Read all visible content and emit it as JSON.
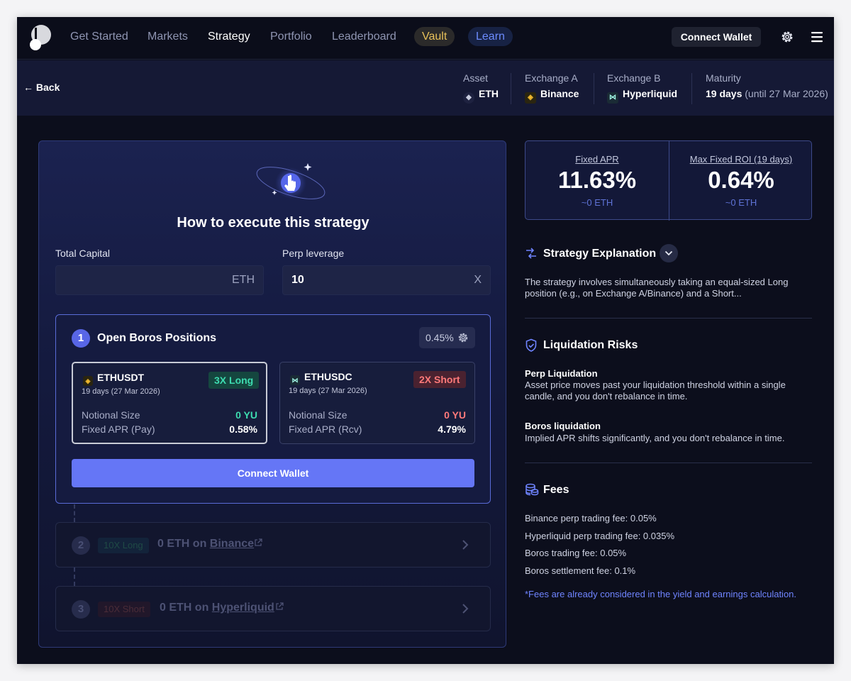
{
  "nav": {
    "items": [
      "Get Started",
      "Markets",
      "Strategy",
      "Portfolio",
      "Leaderboard"
    ],
    "vault": "Vault",
    "learn": "Learn",
    "connect_wallet": "Connect Wallet"
  },
  "subheader": {
    "back": "← Back",
    "asset_label": "Asset",
    "asset": "ETH",
    "exchange_a_label": "Exchange A",
    "exchange_a": "Binance",
    "exchange_b_label": "Exchange B",
    "exchange_b": "Hyperliquid",
    "maturity_label": "Maturity",
    "maturity": "19 days",
    "maturity_until": "(until 27 Mar 2026)"
  },
  "strategy": {
    "title": "How to execute this strategy",
    "total_capital_label": "Total Capital",
    "total_capital_value": "",
    "total_capital_unit": "ETH",
    "leverage_label": "Perp leverage",
    "leverage_value": "10",
    "leverage_unit": "X",
    "step1": {
      "num": "1",
      "title": "Open Boros Positions",
      "slippage": "0.45%",
      "positions": [
        {
          "symbol": "ETHUSDT",
          "date": "19 days  (27 Mar 2026)",
          "tag": "3X Long",
          "notional_label": "Notional Size",
          "notional": "0 YU",
          "apr_label": "Fixed APR (Pay)",
          "apr": "0.58%"
        },
        {
          "symbol": "ETHUSDC",
          "date": "19 days  (27 Mar 2026)",
          "tag": "2X Short",
          "notional_label": "Notional Size",
          "notional": "0 YU",
          "apr_label": "Fixed APR (Rcv)",
          "apr": "4.79%"
        }
      ],
      "button": "Connect Wallet"
    },
    "step2": {
      "num": "2",
      "lev": "10X Long",
      "text_prefix": "0 ETH on",
      "exchange": "Binance"
    },
    "step3": {
      "num": "3",
      "lev": "10X Short",
      "text_prefix": "0 ETH on",
      "exchange": "Hyperliquid"
    }
  },
  "stats": {
    "fixed_apr_label": "Fixed APR",
    "fixed_apr": "11.63%",
    "fixed_apr_sub": "~0 ETH",
    "roi_label": "Max Fixed ROI (19 days)",
    "roi": "0.64%",
    "roi_sub": "~0 ETH"
  },
  "explanation": {
    "title": "Strategy Explanation",
    "text": "The strategy involves simultaneously taking an equal-sized Long position (e.g., on Exchange A/Binance) and a Short..."
  },
  "risks": {
    "title": "Liquidation Risks",
    "perp_title": "Perp Liquidation",
    "perp_text": "Asset price moves past your liquidation threshold within a single candle, and you don't rebalance in time.",
    "boros_title": "Boros liquidation",
    "boros_text": "Implied APR shifts significantly, and you don't rebalance in time."
  },
  "fees": {
    "title": "Fees",
    "items": [
      "Binance perp trading fee: 0.05%",
      "Hyperliquid perp trading fee: 0.035%",
      "Boros trading fee: 0.05%",
      "Boros settlement fee: 0.1%"
    ],
    "note": "*Fees are already considered in the yield and earnings calculation."
  },
  "colors": {
    "background": "#0c0e1c",
    "accent": "#6576f6",
    "long": "#3ddbb0",
    "short": "#ff7a7a",
    "vault": "#e8c15a",
    "learn": "#6d8cff"
  },
  "icons": [
    "logo",
    "gear-icon",
    "menu-icon",
    "eth-icon",
    "binance-icon",
    "hyperliquid-icon",
    "pointer-icon",
    "exchange-icon",
    "shield-icon",
    "coins-icon",
    "chevron-down-icon",
    "chevron-right-icon",
    "external-link-icon"
  ]
}
